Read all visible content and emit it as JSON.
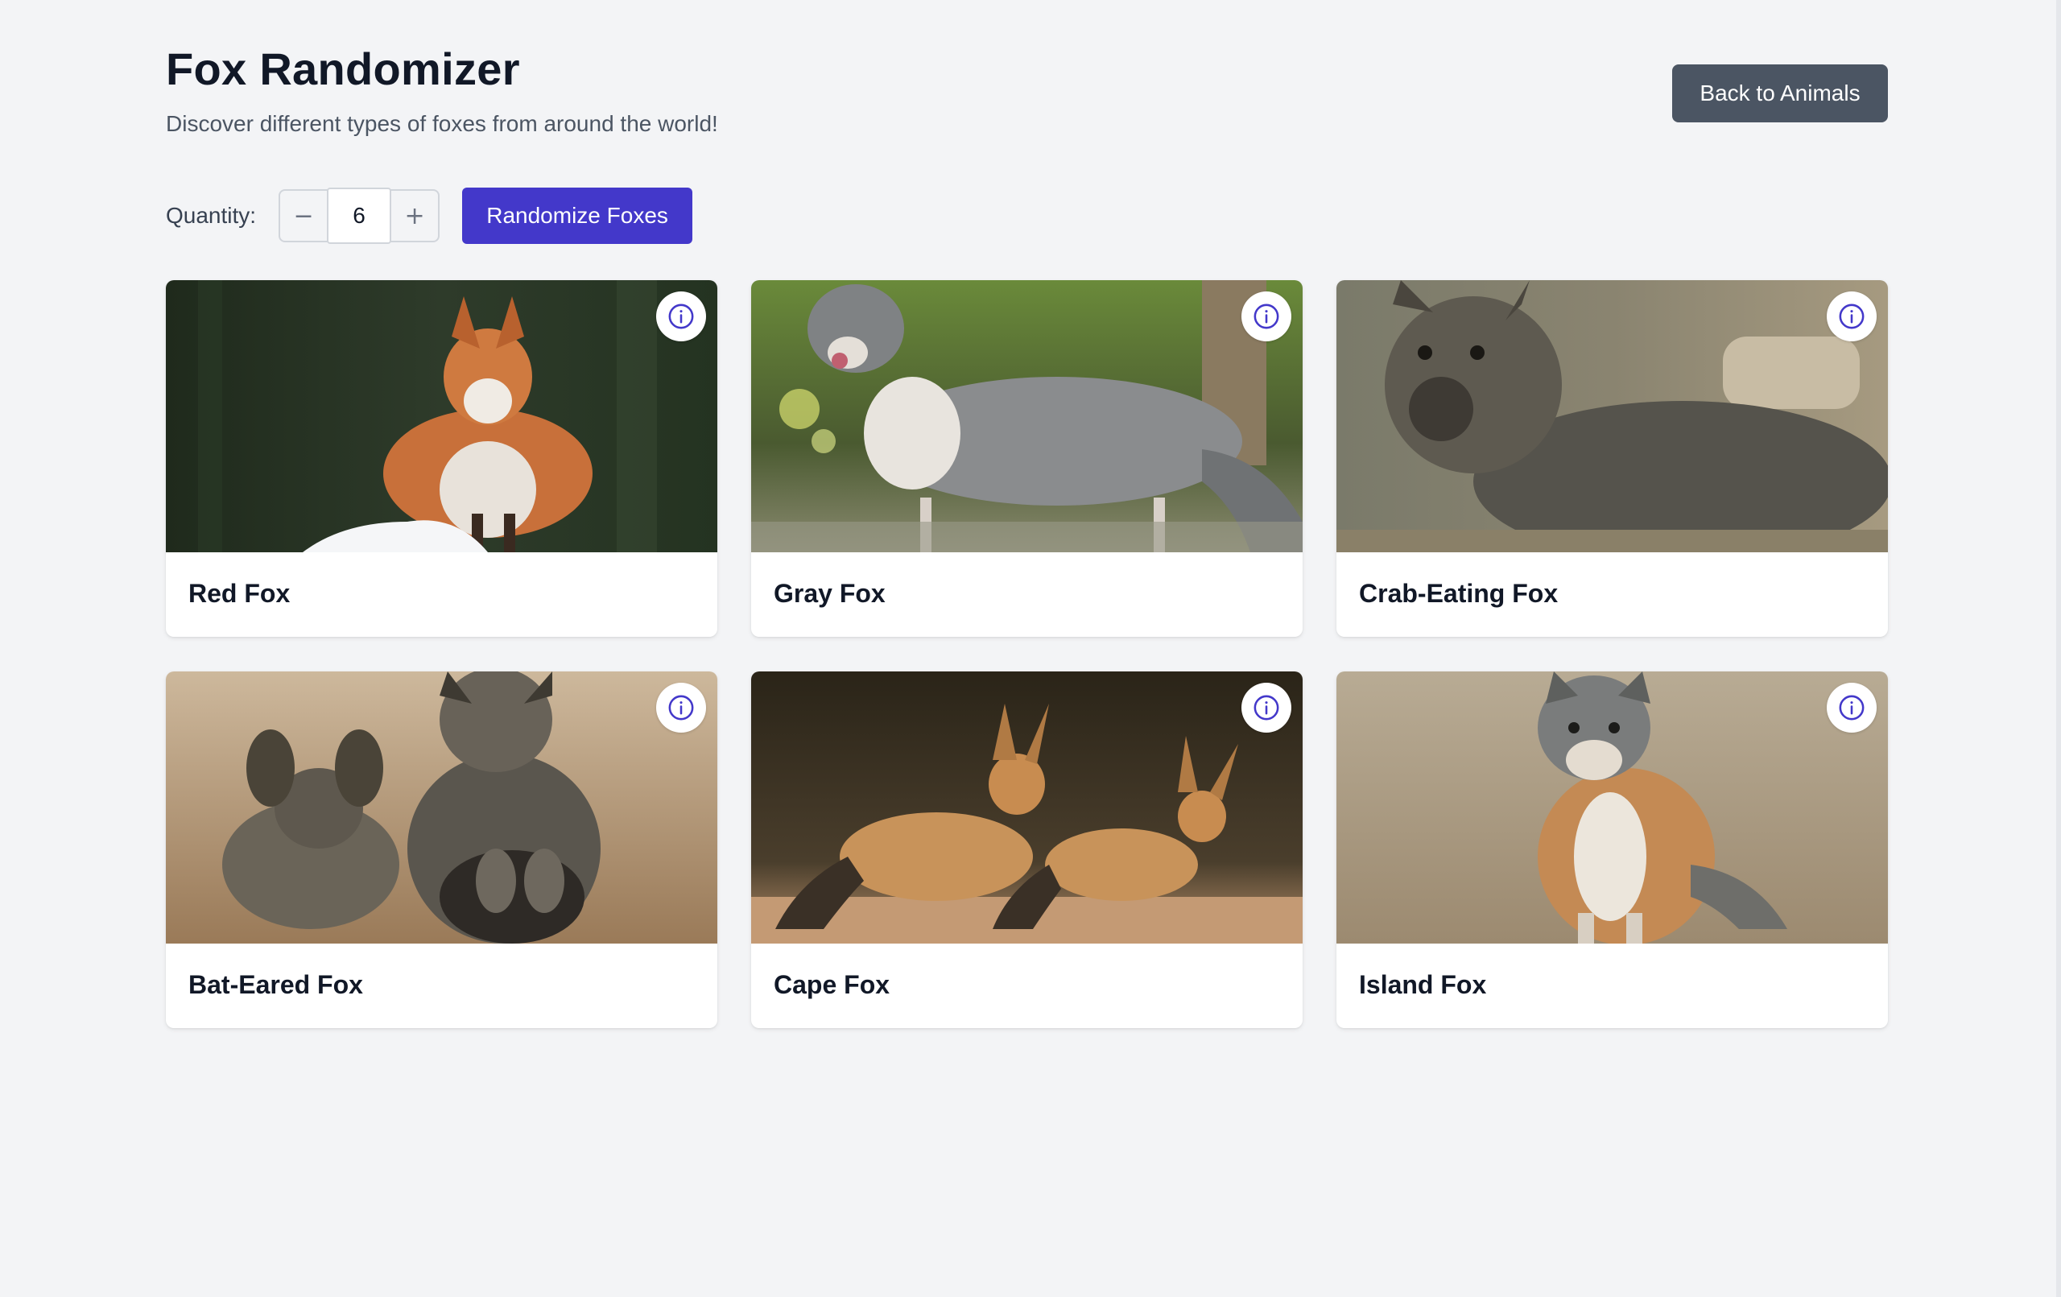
{
  "header": {
    "title": "Fox Randomizer",
    "subtitle": "Discover different types of foxes from around the world!",
    "back_label": "Back to Animals"
  },
  "controls": {
    "quantity_label": "Quantity:",
    "decrement_label": "−",
    "increment_label": "+",
    "quantity_value": "6",
    "randomize_label": "Randomize Foxes"
  },
  "cards": [
    {
      "name": "Red Fox",
      "icon": "info-icon"
    },
    {
      "name": "Gray Fox",
      "icon": "info-icon"
    },
    {
      "name": "Crab-Eating Fox",
      "icon": "info-icon"
    },
    {
      "name": "Bat-Eared Fox",
      "icon": "info-icon"
    },
    {
      "name": "Cape Fox",
      "icon": "info-icon"
    },
    {
      "name": "Island Fox",
      "icon": "info-icon"
    }
  ],
  "colors": {
    "accent": "#4338ca",
    "back_button": "#4b5563",
    "background": "#f3f4f6"
  }
}
